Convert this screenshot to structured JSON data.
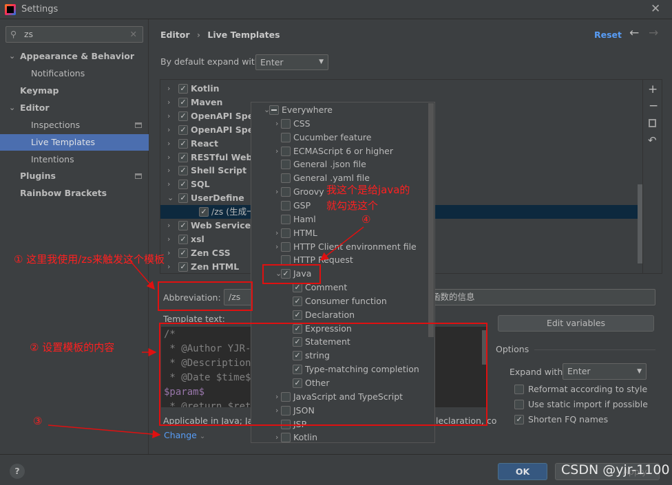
{
  "window": {
    "title": "Settings"
  },
  "search": {
    "value": "zs"
  },
  "sidebar": {
    "items": [
      {
        "label": "Appearance & Behavior",
        "expanded": true
      },
      {
        "label": "Notifications"
      },
      {
        "label": "Keymap"
      },
      {
        "label": "Editor",
        "expanded": true
      },
      {
        "label": "Inspections"
      },
      {
        "label": "Live Templates",
        "selected": true
      },
      {
        "label": "Intentions"
      },
      {
        "label": "Plugins"
      },
      {
        "label": "Rainbow Brackets"
      }
    ]
  },
  "header": {
    "breadcrumb": [
      "Editor",
      "Live Templates"
    ],
    "reset": "Reset"
  },
  "expand_default": {
    "label": "By default expand with",
    "value": "Enter"
  },
  "template_groups": [
    {
      "label": "Kotlin",
      "checked": true
    },
    {
      "label": "Maven",
      "checked": true
    },
    {
      "label": "OpenAPI Speci",
      "checked": true
    },
    {
      "label": "OpenAPI Speci",
      "checked": true
    },
    {
      "label": "React",
      "checked": true
    },
    {
      "label": "RESTful Web S",
      "checked": true
    },
    {
      "label": "Shell Script",
      "checked": true
    },
    {
      "label": "SQL",
      "checked": true
    },
    {
      "label": "UserDefine",
      "checked": true,
      "expanded": true
    },
    {
      "label": "/zs (生成一个",
      "checked": true,
      "child": true,
      "selected": true
    },
    {
      "label": "Web Services",
      "checked": true
    },
    {
      "label": "xsl",
      "checked": true
    },
    {
      "label": "Zen CSS",
      "checked": true
    },
    {
      "label": "Zen HTML",
      "checked": true
    }
  ],
  "context_popup": {
    "items": [
      {
        "label": "Everywhere",
        "state": "partial",
        "level": 0,
        "arrow": "down"
      },
      {
        "label": "CSS",
        "state": "off",
        "level": 1,
        "arrow": "right"
      },
      {
        "label": "Cucumber feature",
        "state": "off",
        "level": 1
      },
      {
        "label": "ECMAScript 6 or higher",
        "state": "off",
        "level": 1,
        "arrow": "right"
      },
      {
        "label": "General .json file",
        "state": "off",
        "level": 1
      },
      {
        "label": "General .yaml file",
        "state": "off",
        "level": 1
      },
      {
        "label": "Groovy",
        "state": "off",
        "level": 1,
        "arrow": "right"
      },
      {
        "label": "GSP",
        "state": "off",
        "level": 1
      },
      {
        "label": "Haml",
        "state": "off",
        "level": 1
      },
      {
        "label": "HTML",
        "state": "off",
        "level": 1,
        "arrow": "right"
      },
      {
        "label": "HTTP Client environment file",
        "state": "off",
        "level": 1,
        "arrow": "right"
      },
      {
        "label": "HTTP Request",
        "state": "off",
        "level": 1
      },
      {
        "label": "Java",
        "state": "on",
        "level": 1,
        "arrow": "down"
      },
      {
        "label": "Comment",
        "state": "on",
        "level": 2
      },
      {
        "label": "Consumer function",
        "state": "on",
        "level": 2
      },
      {
        "label": "Declaration",
        "state": "on",
        "level": 2
      },
      {
        "label": "Expression",
        "state": "on",
        "level": 2
      },
      {
        "label": "Statement",
        "state": "on",
        "level": 2
      },
      {
        "label": "string",
        "state": "on",
        "level": 2
      },
      {
        "label": "Type-matching completion",
        "state": "on",
        "level": 2
      },
      {
        "label": "Other",
        "state": "on",
        "level": 2
      },
      {
        "label": "JavaScript and TypeScript",
        "state": "off",
        "level": 1,
        "arrow": "right"
      },
      {
        "label": "JSON",
        "state": "off",
        "level": 1,
        "arrow": "right"
      },
      {
        "label": "JSP",
        "state": "off",
        "level": 1
      },
      {
        "label": "Kotlin",
        "state": "off",
        "level": 1,
        "arrow": "right"
      }
    ]
  },
  "editor": {
    "abbreviation_label": "Abbreviation:",
    "abbreviation": "/zs",
    "description_tail": "函数的信息",
    "template_label": "Template text:",
    "template_lines": [
      "/*",
      " * @Author YJR-",
      " * @Description",
      " * @Date $time$",
      "$param$",
      " * @return $ret"
    ],
    "applicable": "Applicable in Java; Jav",
    "applicable_tail": "leclaration, co",
    "change": "Change",
    "edit_variables": "Edit variables"
  },
  "options": {
    "title": "Options",
    "expand_label": "Expand with",
    "expand_value": "Enter",
    "checks": [
      {
        "label": "Reformat according to style",
        "checked": false
      },
      {
        "label": "Use static import if possible",
        "checked": false
      },
      {
        "label": "Shorten FQ names",
        "checked": true
      }
    ]
  },
  "footer": {
    "ok": "OK",
    "apply": "Apply",
    "help": "?"
  },
  "annotations": {
    "a1": "① 这里我使用/zs来触发这个模板",
    "a2": "②  设置模板的内容",
    "a3": "③",
    "a4": "④",
    "a4_text1": "我这个是给java的",
    "a4_text2": "就勾选这个"
  },
  "watermark": "CSDN @yjr-1100",
  "colors": {
    "selection": "#4b6eaf",
    "link": "#589df6",
    "annotation": "#ff2020",
    "ok": "#365880"
  }
}
